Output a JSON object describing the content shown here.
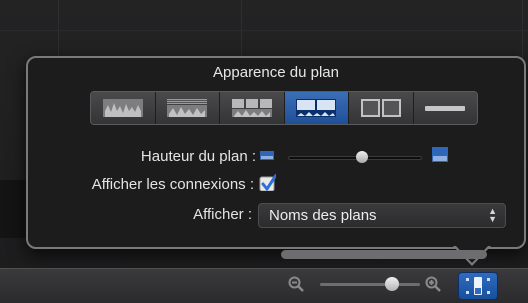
{
  "popover": {
    "title": "Apparence du plan",
    "segments": [
      {
        "icon": "waveform-only-icon",
        "selected": false
      },
      {
        "icon": "large-waveform-filmstrip-icon",
        "selected": false
      },
      {
        "icon": "equal-waveform-filmstrip-icon",
        "selected": false
      },
      {
        "icon": "large-filmstrip-small-waveform-icon",
        "selected": true
      },
      {
        "icon": "filmstrip-only-icon",
        "selected": false
      },
      {
        "icon": "name-only-icon",
        "selected": false
      }
    ],
    "clip_height_label": "Hauteur du plan :",
    "clip_height_value": 0.55,
    "show_connections_label": "Afficher les connexions :",
    "show_connections_checked": true,
    "show_label": "Afficher :",
    "show_value": "Noms des plans"
  },
  "toolbar": {
    "zoom_value": 0.72
  },
  "colors": {
    "accent": "#2f6bc0",
    "panel": "#1c1c1d",
    "border": "#7a7a7c"
  }
}
